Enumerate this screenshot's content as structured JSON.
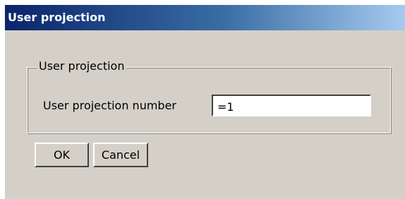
{
  "window": {
    "title": "User projection"
  },
  "group": {
    "legend": "User projection",
    "field_label": "User projection number",
    "field_value": "=1"
  },
  "buttons": {
    "ok_label": "OK",
    "cancel_label": "Cancel"
  },
  "colors": {
    "dialog_background": "#d4d0c8",
    "titlebar_start": "#0a246a",
    "titlebar_end": "#a6caf0",
    "title_text": "#ffffff"
  }
}
